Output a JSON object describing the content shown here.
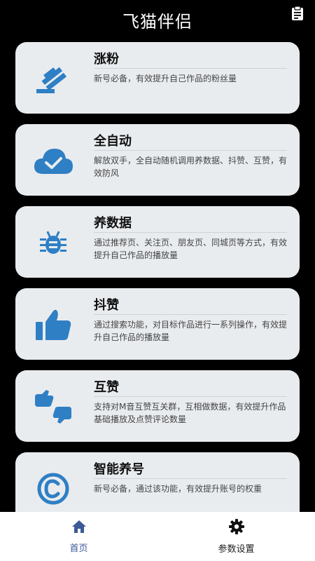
{
  "header": {
    "title": "飞猫伴侣",
    "action_icon": "clipboard-icon"
  },
  "colors": {
    "accent": "#2f7fc4",
    "tab_active": "#3d5a98",
    "card_bg": "#e9ecef",
    "background": "#000000"
  },
  "features": [
    {
      "title": "涨粉",
      "desc": "新号必备，有效提升自己作品的粉丝量",
      "icon": "gavel-icon"
    },
    {
      "title": "全自动",
      "desc": "解放双手，全自动随机调用养数据、抖赞、互赞，有效防风",
      "icon": "cloud-check-icon"
    },
    {
      "title": "养数据",
      "desc": "通过推荐页、关注页、朋友页、同城页等方式，有效提升自己作品的播放量",
      "icon": "bug-icon"
    },
    {
      "title": "抖赞",
      "desc": "通过搜索功能，对目标作品进行一系列操作，有效提升自己作品的播放量",
      "icon": "thumbs-up-icon"
    },
    {
      "title": "互赞",
      "desc": "支持对M音互赞互关群，互相做数据，有效提升作品基础播放及点赞评论数量",
      "icon": "thumbs-up-down-icon"
    },
    {
      "title": "智能养号",
      "desc": "新号必备，通过该功能，有效提升账号的权重",
      "icon": "copyright-icon"
    }
  ],
  "tabs": [
    {
      "label": "首页",
      "icon": "home-icon",
      "active": true
    },
    {
      "label": "参数设置",
      "icon": "gear-icon",
      "active": false
    }
  ]
}
